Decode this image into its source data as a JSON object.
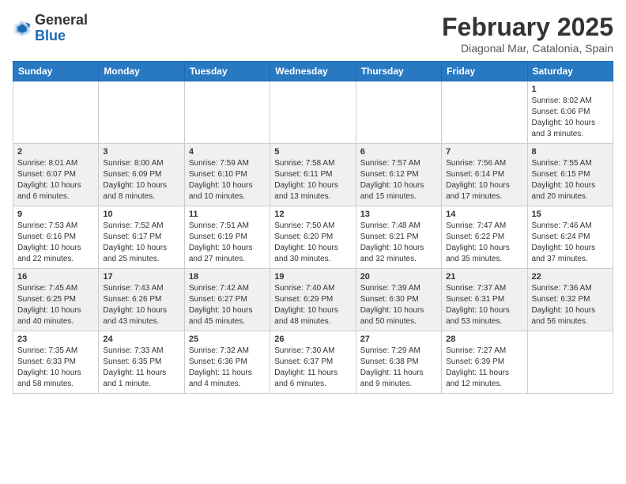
{
  "header": {
    "logo_general": "General",
    "logo_blue": "Blue",
    "month_year": "February 2025",
    "location": "Diagonal Mar, Catalonia, Spain"
  },
  "days_of_week": [
    "Sunday",
    "Monday",
    "Tuesday",
    "Wednesday",
    "Thursday",
    "Friday",
    "Saturday"
  ],
  "weeks": [
    {
      "row_shade": false,
      "days": [
        {
          "number": "",
          "info": ""
        },
        {
          "number": "",
          "info": ""
        },
        {
          "number": "",
          "info": ""
        },
        {
          "number": "",
          "info": ""
        },
        {
          "number": "",
          "info": ""
        },
        {
          "number": "",
          "info": ""
        },
        {
          "number": "1",
          "info": "Sunrise: 8:02 AM\nSunset: 6:06 PM\nDaylight: 10 hours and 3 minutes."
        }
      ]
    },
    {
      "row_shade": true,
      "days": [
        {
          "number": "2",
          "info": "Sunrise: 8:01 AM\nSunset: 6:07 PM\nDaylight: 10 hours and 6 minutes."
        },
        {
          "number": "3",
          "info": "Sunrise: 8:00 AM\nSunset: 6:09 PM\nDaylight: 10 hours and 8 minutes."
        },
        {
          "number": "4",
          "info": "Sunrise: 7:59 AM\nSunset: 6:10 PM\nDaylight: 10 hours and 10 minutes."
        },
        {
          "number": "5",
          "info": "Sunrise: 7:58 AM\nSunset: 6:11 PM\nDaylight: 10 hours and 13 minutes."
        },
        {
          "number": "6",
          "info": "Sunrise: 7:57 AM\nSunset: 6:12 PM\nDaylight: 10 hours and 15 minutes."
        },
        {
          "number": "7",
          "info": "Sunrise: 7:56 AM\nSunset: 6:14 PM\nDaylight: 10 hours and 17 minutes."
        },
        {
          "number": "8",
          "info": "Sunrise: 7:55 AM\nSunset: 6:15 PM\nDaylight: 10 hours and 20 minutes."
        }
      ]
    },
    {
      "row_shade": false,
      "days": [
        {
          "number": "9",
          "info": "Sunrise: 7:53 AM\nSunset: 6:16 PM\nDaylight: 10 hours and 22 minutes."
        },
        {
          "number": "10",
          "info": "Sunrise: 7:52 AM\nSunset: 6:17 PM\nDaylight: 10 hours and 25 minutes."
        },
        {
          "number": "11",
          "info": "Sunrise: 7:51 AM\nSunset: 6:19 PM\nDaylight: 10 hours and 27 minutes."
        },
        {
          "number": "12",
          "info": "Sunrise: 7:50 AM\nSunset: 6:20 PM\nDaylight: 10 hours and 30 minutes."
        },
        {
          "number": "13",
          "info": "Sunrise: 7:48 AM\nSunset: 6:21 PM\nDaylight: 10 hours and 32 minutes."
        },
        {
          "number": "14",
          "info": "Sunrise: 7:47 AM\nSunset: 6:22 PM\nDaylight: 10 hours and 35 minutes."
        },
        {
          "number": "15",
          "info": "Sunrise: 7:46 AM\nSunset: 6:24 PM\nDaylight: 10 hours and 37 minutes."
        }
      ]
    },
    {
      "row_shade": true,
      "days": [
        {
          "number": "16",
          "info": "Sunrise: 7:45 AM\nSunset: 6:25 PM\nDaylight: 10 hours and 40 minutes."
        },
        {
          "number": "17",
          "info": "Sunrise: 7:43 AM\nSunset: 6:26 PM\nDaylight: 10 hours and 43 minutes."
        },
        {
          "number": "18",
          "info": "Sunrise: 7:42 AM\nSunset: 6:27 PM\nDaylight: 10 hours and 45 minutes."
        },
        {
          "number": "19",
          "info": "Sunrise: 7:40 AM\nSunset: 6:29 PM\nDaylight: 10 hours and 48 minutes."
        },
        {
          "number": "20",
          "info": "Sunrise: 7:39 AM\nSunset: 6:30 PM\nDaylight: 10 hours and 50 minutes."
        },
        {
          "number": "21",
          "info": "Sunrise: 7:37 AM\nSunset: 6:31 PM\nDaylight: 10 hours and 53 minutes."
        },
        {
          "number": "22",
          "info": "Sunrise: 7:36 AM\nSunset: 6:32 PM\nDaylight: 10 hours and 56 minutes."
        }
      ]
    },
    {
      "row_shade": false,
      "days": [
        {
          "number": "23",
          "info": "Sunrise: 7:35 AM\nSunset: 6:33 PM\nDaylight: 10 hours and 58 minutes."
        },
        {
          "number": "24",
          "info": "Sunrise: 7:33 AM\nSunset: 6:35 PM\nDaylight: 11 hours and 1 minute."
        },
        {
          "number": "25",
          "info": "Sunrise: 7:32 AM\nSunset: 6:36 PM\nDaylight: 11 hours and 4 minutes."
        },
        {
          "number": "26",
          "info": "Sunrise: 7:30 AM\nSunset: 6:37 PM\nDaylight: 11 hours and 6 minutes."
        },
        {
          "number": "27",
          "info": "Sunrise: 7:29 AM\nSunset: 6:38 PM\nDaylight: 11 hours and 9 minutes."
        },
        {
          "number": "28",
          "info": "Sunrise: 7:27 AM\nSunset: 6:39 PM\nDaylight: 11 hours and 12 minutes."
        },
        {
          "number": "",
          "info": ""
        }
      ]
    }
  ]
}
